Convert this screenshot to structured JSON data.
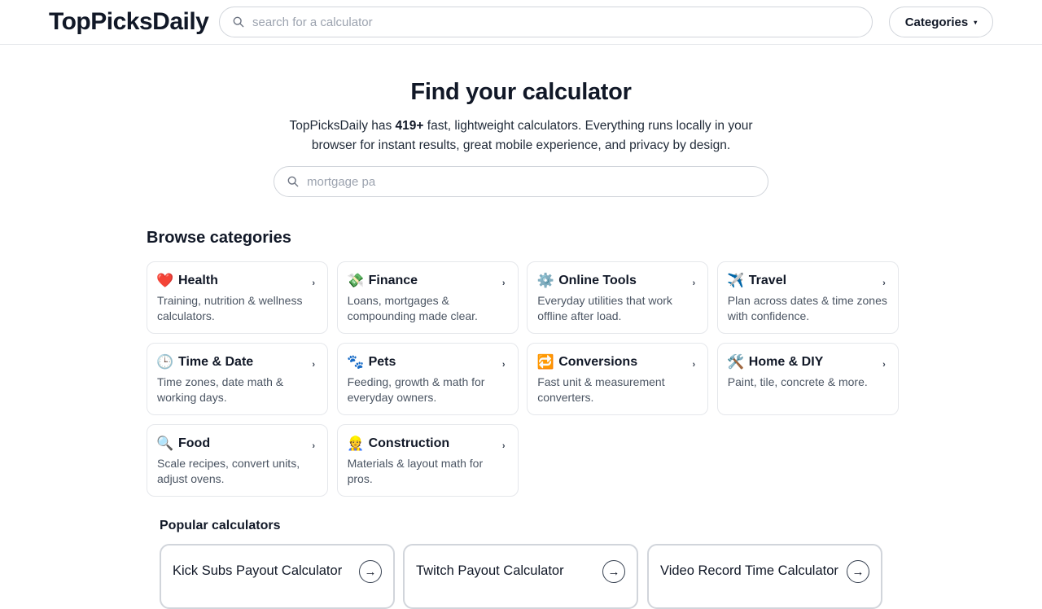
{
  "header": {
    "logo": "TopPicksDaily",
    "search_placeholder": "search for a calculator",
    "categories_label": "Categories",
    "caret": "▾"
  },
  "hero": {
    "title": "Find your calculator",
    "sub_before": "TopPicksDaily has ",
    "sub_count": "419+",
    "sub_after": " fast, lightweight calculators. Everything runs locally in your browser for instant results, great mobile experience, and privacy by design.",
    "search_placeholder": "mortgage pa"
  },
  "categories": {
    "title": "Browse categories",
    "arrow": "›",
    "items": [
      {
        "name": "Health",
        "icon": "heart-icon",
        "glyph": "❤️",
        "desc": "Training, nutrition & wellness calculators."
      },
      {
        "name": "Finance",
        "icon": "money-icon",
        "glyph": "💸",
        "desc": "Loans, mortgages & compounding made clear."
      },
      {
        "name": "Online Tools",
        "icon": "gear-icon",
        "glyph": "⚙️",
        "desc": "Everyday utilities that work offline after load."
      },
      {
        "name": "Travel",
        "icon": "airplane-icon",
        "glyph": "✈️",
        "desc": "Plan across dates & time zones with confidence."
      },
      {
        "name": "Time & Date",
        "icon": "clock-icon",
        "glyph": "🕒",
        "desc": "Time zones, date math & working days."
      },
      {
        "name": "Pets",
        "icon": "paw-icon",
        "glyph": "🐾",
        "desc": "Feeding, growth & math for everyday owners."
      },
      {
        "name": "Conversions",
        "icon": "arrows-cycle-icon",
        "glyph": "🔁",
        "desc": "Fast unit & measurement converters."
      },
      {
        "name": "Home & DIY",
        "icon": "tools-icon",
        "glyph": "🛠️",
        "desc": "Paint, tile, concrete & more."
      },
      {
        "name": "Food",
        "icon": "magnifier-icon",
        "glyph": "🔍",
        "desc": "Scale recipes, convert units, adjust ovens."
      },
      {
        "name": "Construction",
        "icon": "construction-worker-icon",
        "glyph": "👷",
        "desc": "Materials & layout math for pros."
      }
    ]
  },
  "popular": {
    "title": "Popular calculators",
    "arrow": "→",
    "items": [
      {
        "name": "Kick Subs Payout Calculator"
      },
      {
        "name": "Twitch Payout Calculator"
      },
      {
        "name": "Video Record Time Calculator"
      }
    ]
  }
}
